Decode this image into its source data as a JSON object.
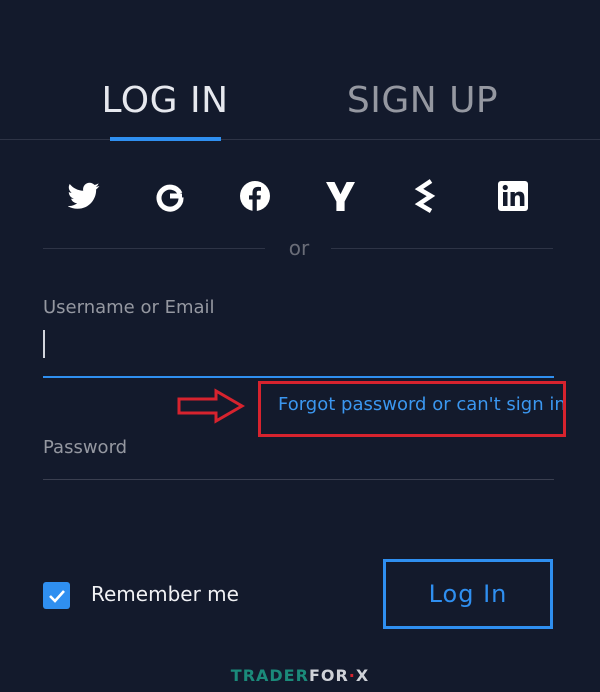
{
  "tabs": {
    "login": "LOG IN",
    "signup": "SIGN UP"
  },
  "social_icons": [
    "twitter-icon",
    "google-icon",
    "facebook-icon",
    "yahoo-icon",
    "stocktwits-icon",
    "linkedin-icon"
  ],
  "divider_text": "or",
  "username": {
    "label": "Username or Email",
    "value": ""
  },
  "forgot_link": "Forgot password or can't sign in",
  "password": {
    "label": "Password",
    "value": ""
  },
  "remember": {
    "label": "Remember me",
    "checked": true
  },
  "login_button": "Log In",
  "watermark": {
    "part1": "TRADER",
    "part2": "FOR",
    "part3": "X"
  },
  "colors": {
    "background": "#131a2c",
    "accent": "#2f8ff0",
    "annotation": "#d7232e"
  }
}
